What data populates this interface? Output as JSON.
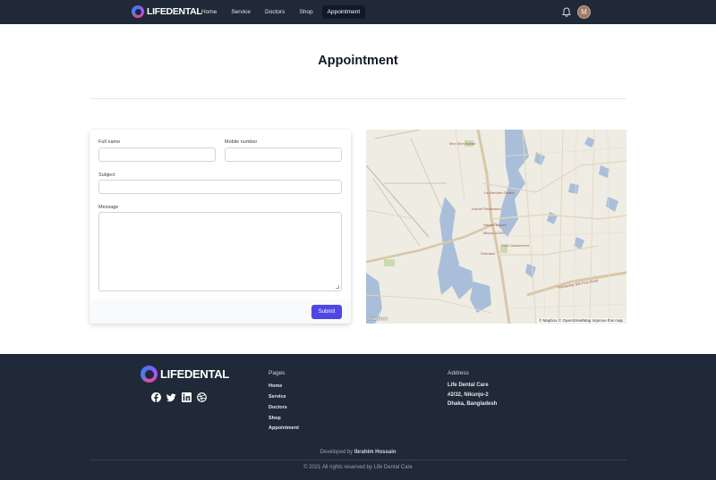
{
  "brand": {
    "name": "LIFEDENTAL"
  },
  "nav": {
    "items": [
      {
        "label": "Home",
        "active": false
      },
      {
        "label": "Service",
        "active": false
      },
      {
        "label": "Doctors",
        "active": false
      },
      {
        "label": "Shop",
        "active": false
      },
      {
        "label": "Appointment",
        "active": true
      }
    ],
    "avatar_initial": "M",
    "notification_icon": "bell-icon"
  },
  "page": {
    "title": "Appointment"
  },
  "form": {
    "full_name_label": "Full name",
    "full_name_value": "",
    "mobile_label": "Mobile number",
    "mobile_value": "",
    "subject_label": "Subject",
    "subject_value": "",
    "message_label": "Message",
    "message_value": "",
    "submit_label": "Submit"
  },
  "map": {
    "labels": [
      "Mon Mon Kabab",
      "La Meridien Dhaka",
      "Kacchi Restaurant",
      "Nawab Biryani",
      "Mirpur DOHS",
      "RAB Cantonment",
      "Sheraton",
      "Purbachal 300 Feet Road"
    ],
    "logo": "mapbox",
    "attribution": "© Mapbox © OpenStreetMap Improve this map"
  },
  "footer": {
    "pages_heading": "Pages",
    "pages": [
      "Home",
      "Service",
      "Doctors",
      "Shop",
      "Appointment"
    ],
    "address_heading": "Address",
    "address_lines": [
      "Life Dental Care",
      "#2/32, Nikunjo-2",
      "Dhaka, Bangladesh"
    ],
    "socials": [
      "facebook-icon",
      "twitter-icon",
      "linkedin-icon",
      "dribbble-icon"
    ],
    "developed_prefix": "Developed by",
    "developer": "Ibrahim Hossain",
    "copyright": "© 2021 All rights reserved by Life Dental Care"
  },
  "colors": {
    "nav_bg": "#1f2937",
    "accent": "#4f46e5",
    "footer_bg": "#1f2937"
  }
}
